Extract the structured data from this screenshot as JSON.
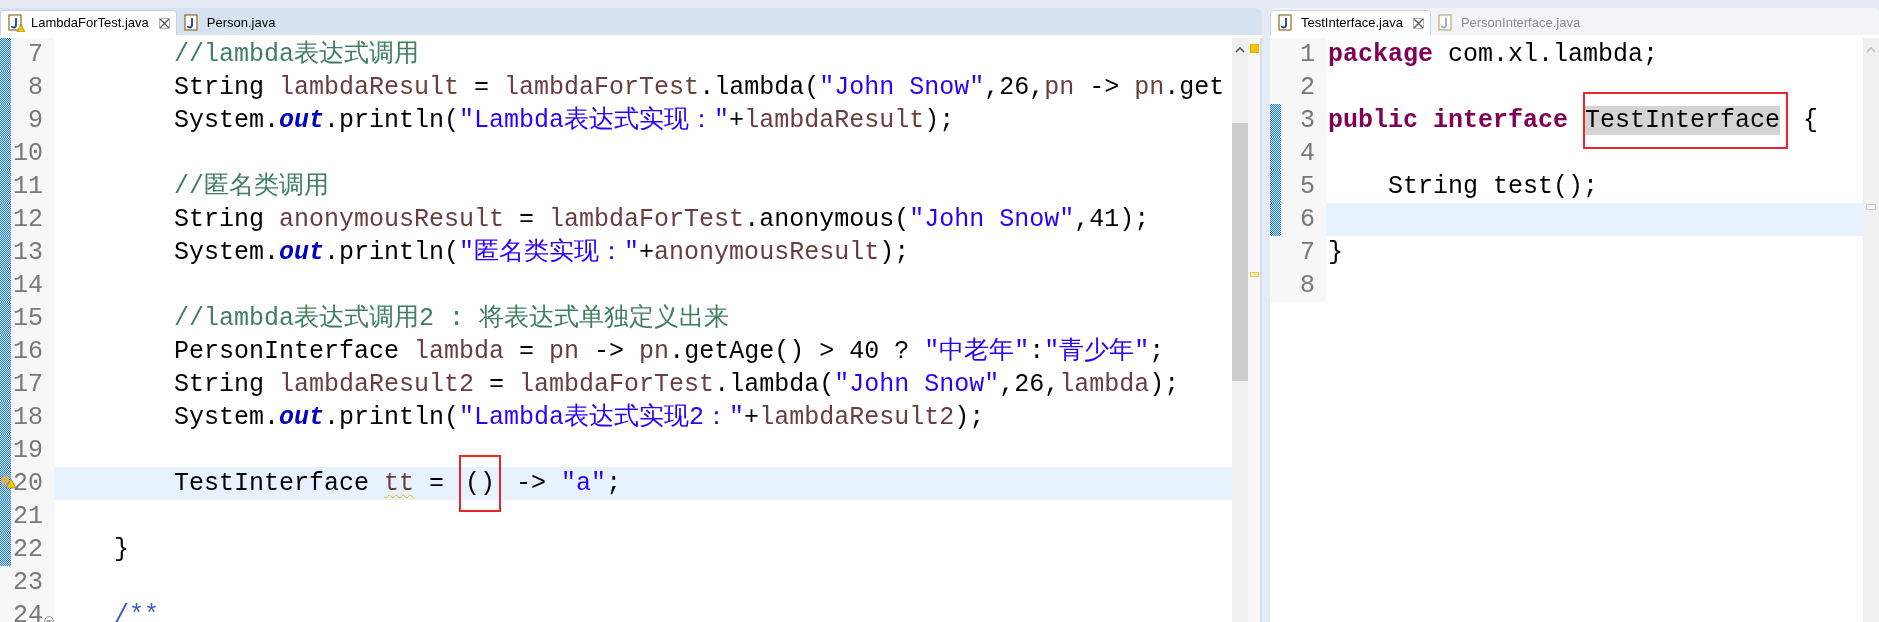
{
  "panes": [
    {
      "focused": true,
      "tabs": [
        {
          "label": "LambdaForTest.java",
          "selected": true,
          "warning": true
        },
        {
          "label": "Person.java",
          "selected": false,
          "warning": false
        }
      ],
      "lines": [
        {
          "number": "7",
          "changed": true,
          "current": false,
          "tokens": [
            {
              "text": "        //lambda表达式调用",
              "kind": "comment"
            }
          ]
        },
        {
          "number": "8",
          "changed": true,
          "current": false,
          "tokens": [
            {
              "text": "        String ",
              "kind": "plain"
            },
            {
              "text": "lambdaResult",
              "kind": "local"
            },
            {
              "text": " = ",
              "kind": "plain"
            },
            {
              "text": "lambdaForTest",
              "kind": "local"
            },
            {
              "text": ".lambda(",
              "kind": "plain"
            },
            {
              "text": "\"John Snow\"",
              "kind": "string"
            },
            {
              "text": ",26,",
              "kind": "plain"
            },
            {
              "text": "pn",
              "kind": "local"
            },
            {
              "text": " -> ",
              "kind": "plain"
            },
            {
              "text": "pn",
              "kind": "local"
            },
            {
              "text": ".get",
              "kind": "plain"
            }
          ]
        },
        {
          "number": "9",
          "changed": true,
          "current": false,
          "tokens": [
            {
              "text": "        System.",
              "kind": "plain"
            },
            {
              "text": "out",
              "kind": "field"
            },
            {
              "text": ".println(",
              "kind": "plain"
            },
            {
              "text": "\"Lambda表达式实现：\"",
              "kind": "string"
            },
            {
              "text": "+",
              "kind": "plain"
            },
            {
              "text": "lambdaResult",
              "kind": "local"
            },
            {
              "text": ");",
              "kind": "plain"
            }
          ]
        },
        {
          "number": "10",
          "changed": true,
          "current": false
        },
        {
          "number": "11",
          "changed": true,
          "current": false,
          "tokens": [
            {
              "text": "        //匿名类调用",
              "kind": "comment"
            }
          ]
        },
        {
          "number": "12",
          "changed": true,
          "current": false,
          "tokens": [
            {
              "text": "        String ",
              "kind": "plain"
            },
            {
              "text": "anonymousResult",
              "kind": "local"
            },
            {
              "text": " = ",
              "kind": "plain"
            },
            {
              "text": "lambdaForTest",
              "kind": "local"
            },
            {
              "text": ".anonymous(",
              "kind": "plain"
            },
            {
              "text": "\"John Snow\"",
              "kind": "string"
            },
            {
              "text": ",41);",
              "kind": "plain"
            }
          ]
        },
        {
          "number": "13",
          "changed": true,
          "current": false,
          "tokens": [
            {
              "text": "        System.",
              "kind": "plain"
            },
            {
              "text": "out",
              "kind": "field"
            },
            {
              "text": ".println(",
              "kind": "plain"
            },
            {
              "text": "\"匿名类实现：\"",
              "kind": "string"
            },
            {
              "text": "+",
              "kind": "plain"
            },
            {
              "text": "anonymousResult",
              "kind": "local"
            },
            {
              "text": ");",
              "kind": "plain"
            }
          ]
        },
        {
          "number": "14",
          "changed": true,
          "current": false
        },
        {
          "number": "15",
          "changed": true,
          "current": false,
          "tokens": [
            {
              "text": "        //lambda表达式调用2 : 将表达式单独定义出来",
              "kind": "comment"
            }
          ]
        },
        {
          "number": "16",
          "changed": true,
          "current": false,
          "tokens": [
            {
              "text": "        PersonInterface ",
              "kind": "plain"
            },
            {
              "text": "lambda",
              "kind": "local"
            },
            {
              "text": " = ",
              "kind": "plain"
            },
            {
              "text": "pn",
              "kind": "local"
            },
            {
              "text": " -> ",
              "kind": "plain"
            },
            {
              "text": "pn",
              "kind": "local"
            },
            {
              "text": ".getAge() > 40 ? ",
              "kind": "plain"
            },
            {
              "text": "\"中老年\"",
              "kind": "string"
            },
            {
              "text": ":",
              "kind": "plain"
            },
            {
              "text": "\"青少年\"",
              "kind": "string"
            },
            {
              "text": ";",
              "kind": "plain"
            }
          ]
        },
        {
          "number": "17",
          "changed": true,
          "current": false,
          "tokens": [
            {
              "text": "        String ",
              "kind": "plain"
            },
            {
              "text": "lambdaResult2",
              "kind": "local"
            },
            {
              "text": " = ",
              "kind": "plain"
            },
            {
              "text": "lambdaForTest",
              "kind": "local"
            },
            {
              "text": ".lambda(",
              "kind": "plain"
            },
            {
              "text": "\"John Snow\"",
              "kind": "string"
            },
            {
              "text": ",26,",
              "kind": "plain"
            },
            {
              "text": "lambda",
              "kind": "local"
            },
            {
              "text": ");",
              "kind": "plain"
            }
          ]
        },
        {
          "number": "18",
          "changed": true,
          "current": false,
          "tokens": [
            {
              "text": "        System.",
              "kind": "plain"
            },
            {
              "text": "out",
              "kind": "field"
            },
            {
              "text": ".println(",
              "kind": "plain"
            },
            {
              "text": "\"Lambda表达式实现2：\"",
              "kind": "string"
            },
            {
              "text": "+",
              "kind": "plain"
            },
            {
              "text": "lambdaResult2",
              "kind": "local"
            },
            {
              "text": ");",
              "kind": "plain"
            }
          ]
        },
        {
          "number": "19",
          "changed": true,
          "current": false
        },
        {
          "number": "20",
          "changed": true,
          "current": true,
          "warning": true,
          "tokens": [
            {
              "text": "        TestInterface ",
              "kind": "plain"
            },
            {
              "text": "tt",
              "kind": "local-warning"
            },
            {
              "text": " = ",
              "kind": "plain"
            },
            {
              "text": "()",
              "kind": "boxed"
            },
            {
              "text": " -> ",
              "kind": "plain"
            },
            {
              "text": "\"a\"",
              "kind": "string"
            },
            {
              "text": ";",
              "kind": "plain"
            }
          ]
        },
        {
          "number": "21",
          "changed": true,
          "current": false
        },
        {
          "number": "22",
          "changed": true,
          "current": false,
          "tokens": [
            {
              "text": "    }",
              "kind": "plain"
            }
          ]
        },
        {
          "number": "23",
          "changed": false,
          "current": false
        },
        {
          "number": "24",
          "changed": false,
          "current": false,
          "foldable": true,
          "tokens": [
            {
              "text": "    /**",
              "kind": "javadoc"
            }
          ]
        }
      ]
    },
    {
      "focused": false,
      "tabs": [
        {
          "label": "TestInterface.java",
          "selected": true,
          "warning": false
        },
        {
          "label": "PersonInterface.java",
          "selected": false,
          "warning": false
        }
      ],
      "lines": [
        {
          "number": "1",
          "changed": false,
          "current": false,
          "tokens": [
            {
              "text": "package ",
              "kind": "keyword"
            },
            {
              "text": "com.xl.lambda;",
              "kind": "plain"
            }
          ]
        },
        {
          "number": "2",
          "changed": false,
          "current": false
        },
        {
          "number": "3",
          "changed": true,
          "current": false,
          "tokens": [
            {
              "text": "public ",
              "kind": "keyword"
            },
            {
              "text": "interface ",
              "kind": "keyword"
            },
            {
              "text": "TestInterface",
              "kind": "occurrence-boxed"
            },
            {
              "text": " {",
              "kind": "plain"
            }
          ]
        },
        {
          "number": "4",
          "changed": true,
          "current": false
        },
        {
          "number": "5",
          "changed": true,
          "current": false,
          "tokens": [
            {
              "text": "    String test();",
              "kind": "plain"
            }
          ]
        },
        {
          "number": "6",
          "changed": true,
          "current": true
        },
        {
          "number": "7",
          "changed": false,
          "current": false,
          "tokens": [
            {
              "text": "}",
              "kind": "plain"
            }
          ]
        },
        {
          "number": "8",
          "changed": false,
          "current": false
        }
      ]
    }
  ]
}
